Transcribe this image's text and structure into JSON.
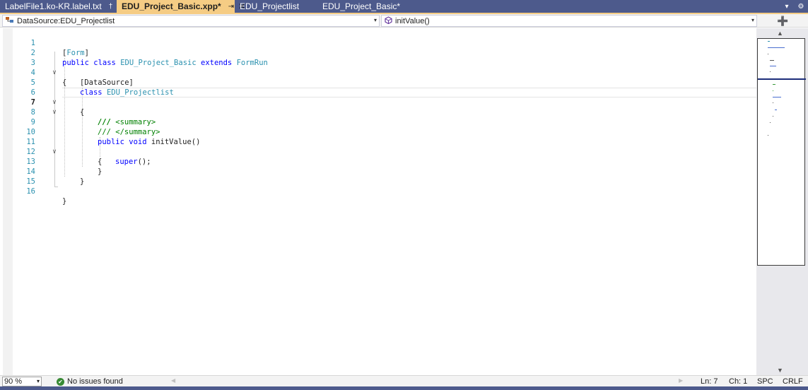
{
  "tabs": [
    {
      "label": "LabelFile1.ko-KR.label.txt",
      "pin": "†"
    },
    {
      "label": "EDU_Project_Basic.xpp*",
      "pin": "⇥",
      "close": "✕"
    },
    {
      "label": "EDU_Projectlist"
    },
    {
      "label": "EDU_Project_Basic*"
    }
  ],
  "tab_controls": {
    "dropdown": "▾",
    "settings": "⚙"
  },
  "navigation": {
    "datasource_combo": "DataSource:EDU_Projectlist",
    "method_combo": "initValue()",
    "combo_arrow": "▾",
    "split_button": "➕"
  },
  "code": {
    "line_numbers": [
      "1",
      "2",
      "3",
      "4",
      "5",
      "6",
      "7",
      "8",
      "9",
      "10",
      "11",
      "12",
      "13",
      "14",
      "15",
      "16"
    ],
    "active_line": 7,
    "fold_glyph": "∨"
  },
  "tokens": {
    "bracket_open": "[",
    "bracket_close": "]",
    "form_attr": "Form",
    "public": "public",
    "class": "class",
    "class_name": "EDU_Project_Basic",
    "extends": "extends",
    "base_class": "FormRun",
    "brace_open": "{",
    "brace_close": "}",
    "datasource_attr": "[DataSource]",
    "ds_class": "EDU_Projectlist",
    "doc_summary_open": "/// <summary>",
    "doc_empty": "///",
    "doc_summary_close": "/// </summary>",
    "void": "void",
    "method_sig": "initValue()",
    "super": "super",
    "super_tail": "();"
  },
  "status": {
    "zoom": "90 %",
    "zoom_arrow": "▾",
    "issues": "No issues found",
    "ok_glyph": "✔",
    "scroll_left": "◀",
    "scroll_right": "▶",
    "line": "Ln: 7",
    "col": "Ch: 1",
    "indent": "SPC",
    "eol": "CRLF"
  },
  "minimap": {
    "up": "▲",
    "down": "▼"
  },
  "colors": {
    "tab_strip": "#4d5a8c",
    "active_tab": "#f5cc84",
    "keyword": "#0000ff",
    "type": "#2b91af",
    "comment": "#008000",
    "line_number": "#2b91af"
  }
}
